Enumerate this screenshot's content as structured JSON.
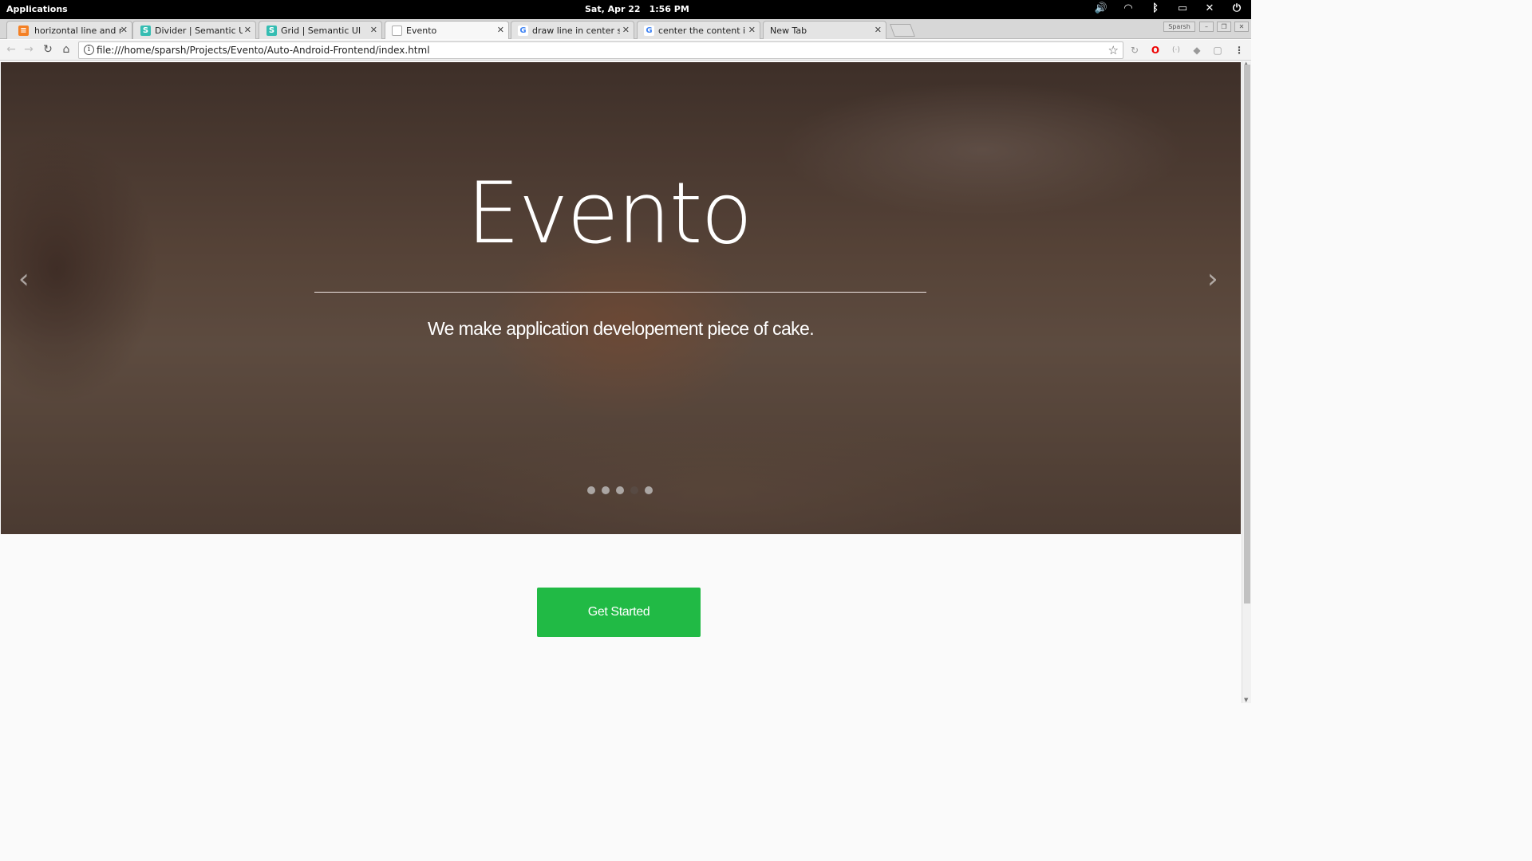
{
  "system_bar": {
    "applications": "Applications",
    "date": "Sat, Apr 22",
    "time": "1:56 PM",
    "tray_icons": [
      "volume-icon",
      "wifi-icon",
      "bluetooth-icon",
      "battery-icon",
      "notifications-off-icon",
      "power-icon"
    ]
  },
  "browser": {
    "tabs": [
      {
        "label": "horizontal line and righ",
        "favicon": "stackoverflow-icon",
        "active": false
      },
      {
        "label": "Divider | Semantic UI",
        "favicon": "semantic-ui-icon",
        "active": false
      },
      {
        "label": "Grid | Semantic UI",
        "favicon": "semantic-ui-icon",
        "active": false
      },
      {
        "label": "Evento",
        "favicon": "page-icon",
        "active": true
      },
      {
        "label": "draw line in center sem",
        "favicon": "google-icon",
        "active": false
      },
      {
        "label": "center the content in di",
        "favicon": "google-icon",
        "active": false
      },
      {
        "label": "New Tab",
        "favicon": "",
        "active": false
      }
    ],
    "profile_label": "Sparsh",
    "url": "file:///home/sparsh/Projects/Evento/Auto-Android-Frontend/index.html",
    "extension_icons": [
      "reload-extension-icon",
      "opera-icon",
      "cast-icon",
      "shield-icon",
      "extension-icon",
      "menu-icon"
    ]
  },
  "page": {
    "hero": {
      "title": "Evento",
      "subtitle": "We make application developement piece of cake.",
      "slides_count": 5,
      "active_slide_index": 3
    },
    "cta": {
      "label": "Get Started",
      "color": "#21ba45"
    }
  }
}
